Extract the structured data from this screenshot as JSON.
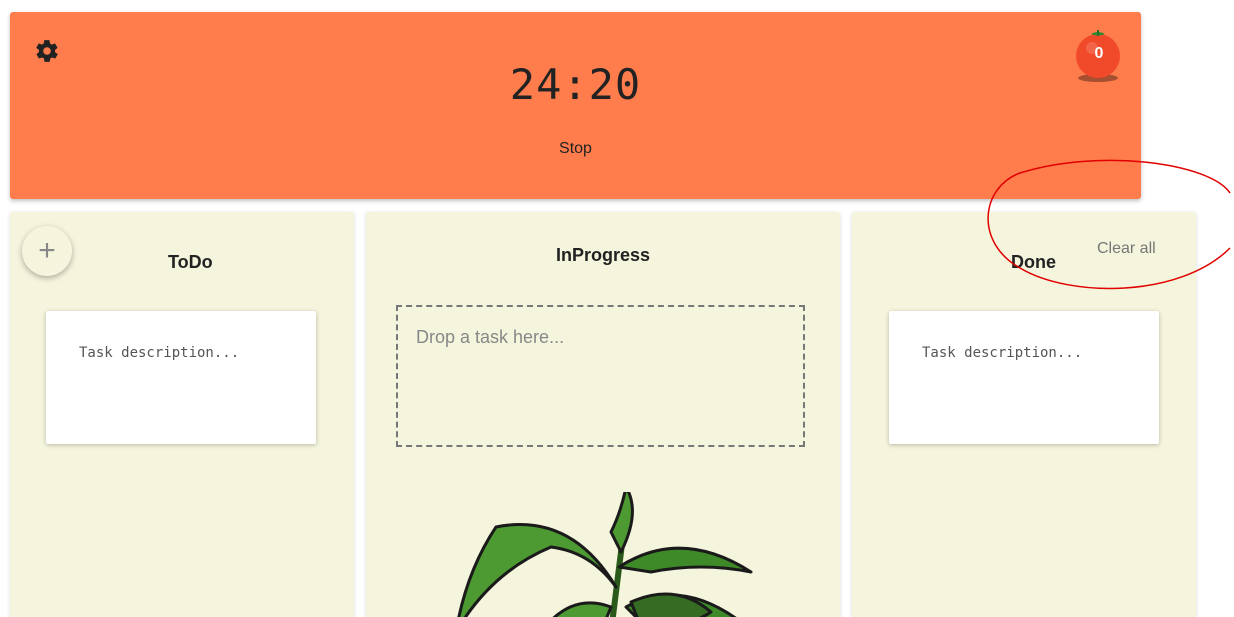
{
  "header": {
    "timer": "24:20",
    "stop_label": "Stop",
    "tomato_count": "0",
    "bg_color": "#ff7c4c"
  },
  "columns": {
    "todo": {
      "title": "ToDo",
      "add_label": "+",
      "task_placeholder": "Task description..."
    },
    "in_progress": {
      "title": "InProgress",
      "drop_placeholder": "Drop a task here..."
    },
    "done": {
      "title": "Done",
      "clear_label": "Clear all",
      "task_placeholder": "Task description..."
    }
  },
  "icons": {
    "settings": "gear-icon",
    "tomato": "tomato-icon",
    "plant": "plant-illustration"
  },
  "colors": {
    "column_bg": "#f5f4dc",
    "annotation": "#e00000"
  }
}
